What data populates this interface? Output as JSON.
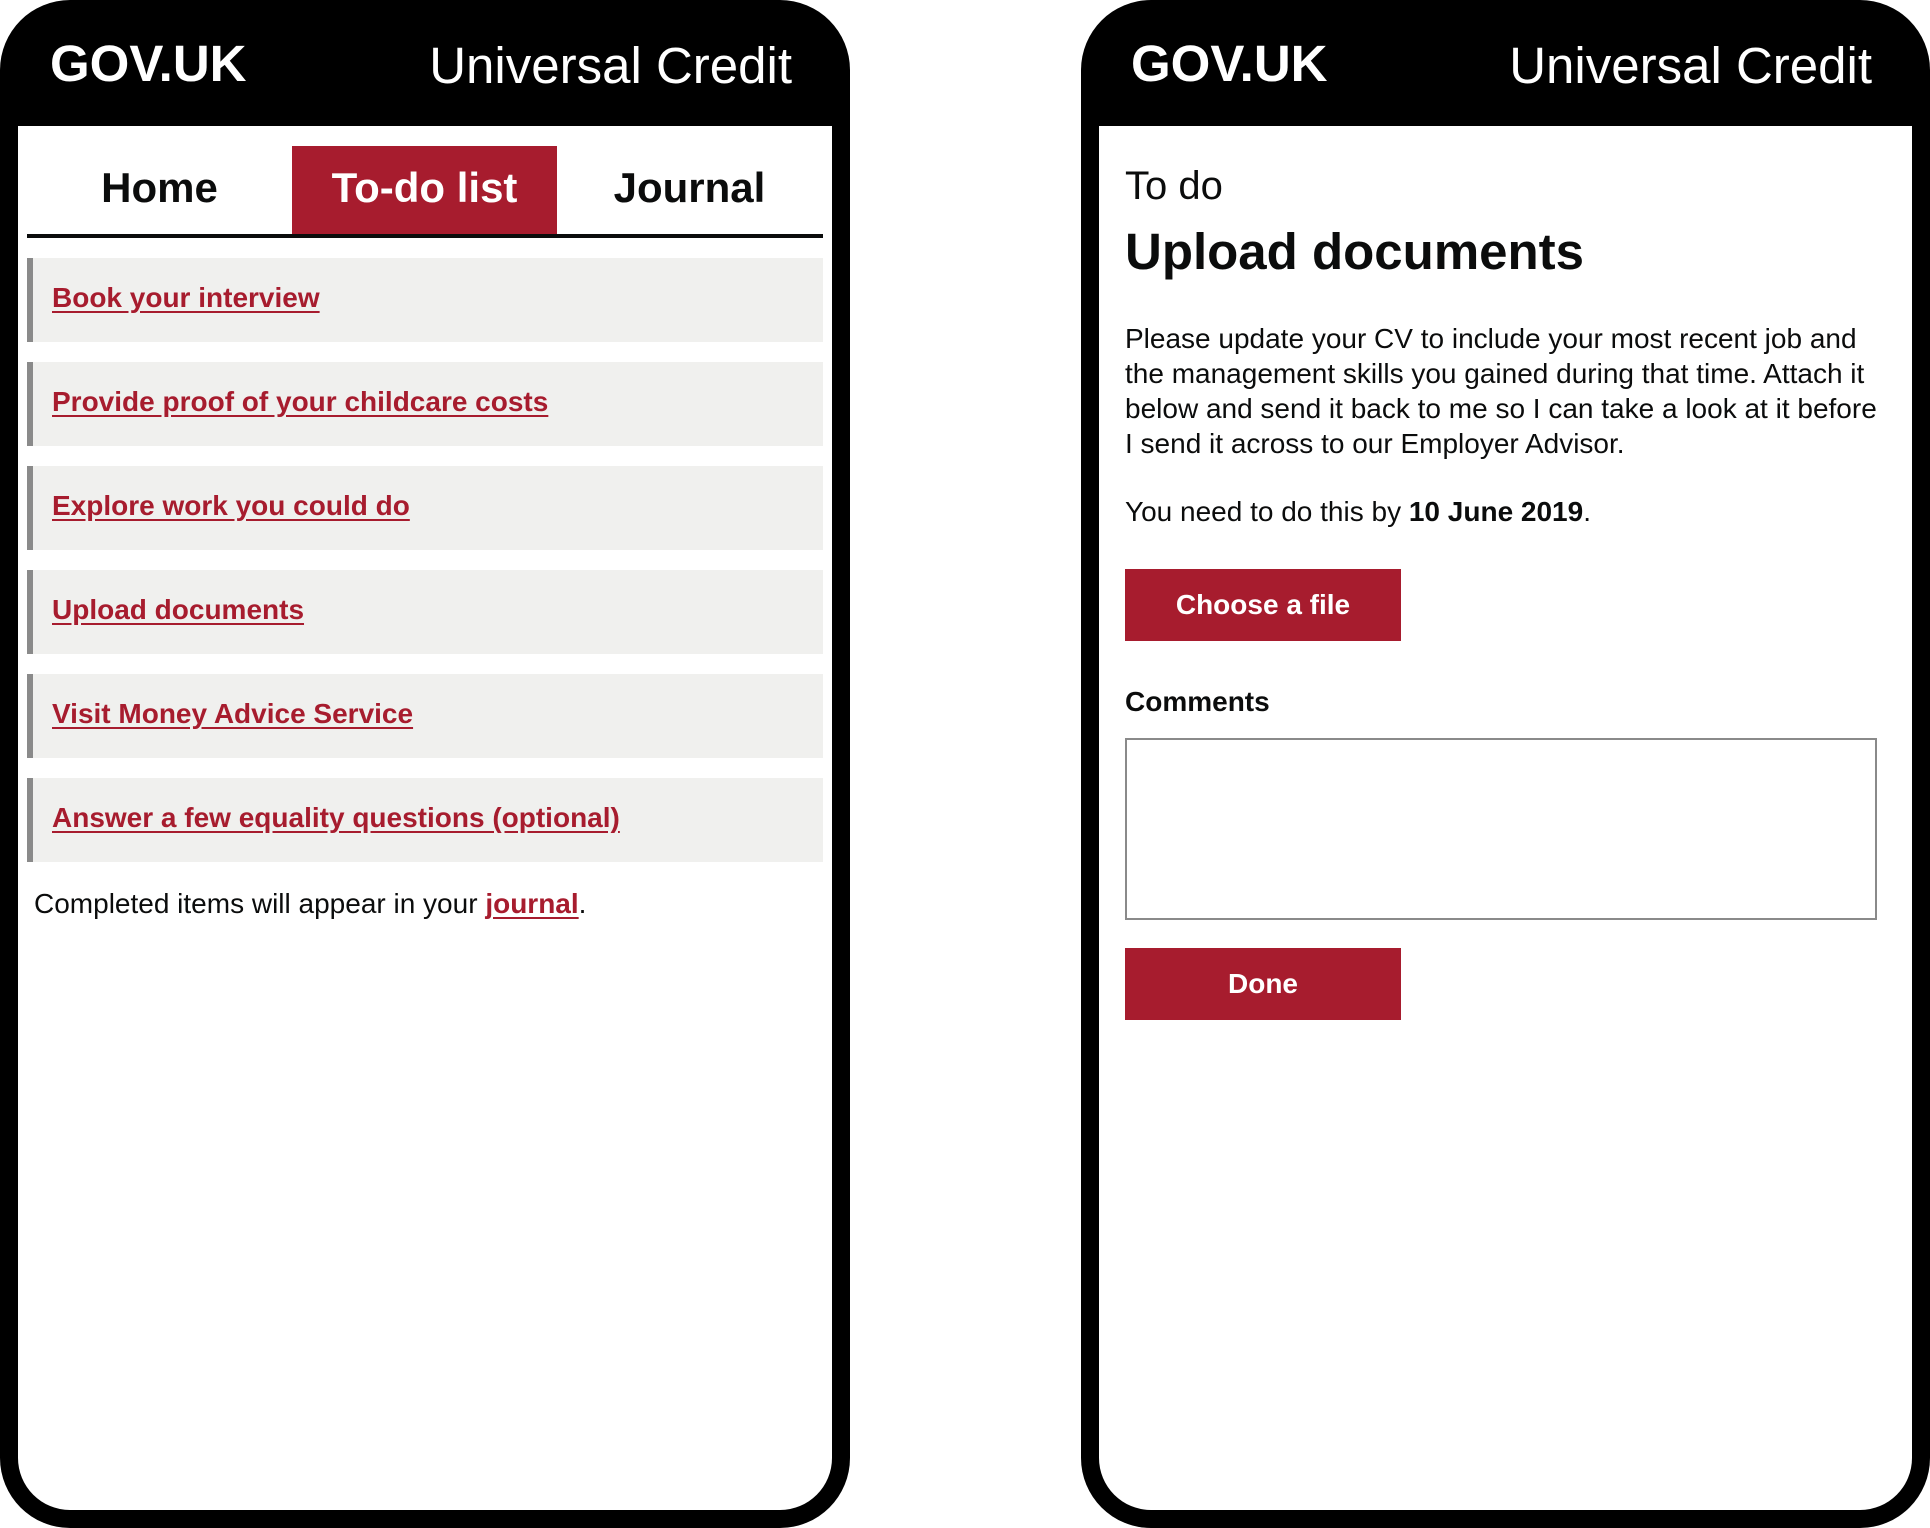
{
  "left_phone": {
    "header": {
      "brand": "GOV.UK",
      "service": "Universal Credit"
    },
    "tabs": [
      {
        "label": "Home",
        "active": false
      },
      {
        "label": "To-do list",
        "active": true
      },
      {
        "label": "Journal",
        "active": false
      }
    ],
    "todo_items": [
      {
        "label": "Book your interview"
      },
      {
        "label": "Provide proof of your childcare costs"
      },
      {
        "label": "Explore work you could do"
      },
      {
        "label": "Upload documents"
      },
      {
        "label": "Visit Money Advice Service"
      },
      {
        "label": "Answer a few equality questions (optional)"
      }
    ],
    "footnote": {
      "prefix": "Completed items will appear in your ",
      "link": "journal",
      "suffix": "."
    }
  },
  "right_phone": {
    "header": {
      "brand": "GOV.UK",
      "service": "Universal Credit"
    },
    "caption": "To do",
    "title": "Upload documents",
    "body": "Please update your CV to include your most recent job and the management skills you gained during that time. Attach it below and send it back to me so I can take a look at it before I send it across to our Employer Advisor.",
    "deadline": {
      "prefix": "You need to do this by ",
      "date": "10 June 2019",
      "suffix": "."
    },
    "choose_file_label": "Choose a file",
    "comments_label": "Comments",
    "comments_value": "",
    "done_label": "Done"
  },
  "colors": {
    "accent": "#a71c2e",
    "header_bg": "#000000",
    "item_bg": "#f0f0ee",
    "item_border": "#8a8a8a",
    "text": "#0b0c0c"
  }
}
